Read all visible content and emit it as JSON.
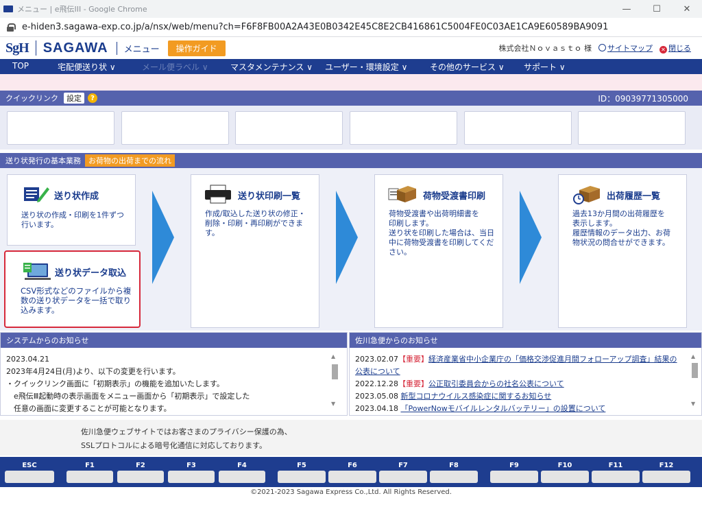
{
  "browser": {
    "title": "メニュー | e飛伝III - Google Chrome",
    "url": "e-hiden3.sagawa-exp.co.jp/a/nsx/web/menu?ch=F6F8FB00A2A43E0B0342E45C8E2CB416861C5004FE0C03AE1CA9E60589BA9091",
    "min": "—",
    "max": "☐",
    "close": "✕"
  },
  "header": {
    "logo_sgh": "SgH",
    "logo_sagawa": "SAGAWA",
    "menu_label": "メニュー",
    "guide_button": "操作ガイド",
    "company": "株式会社Ｎｏｖａｓｔｏ 様",
    "sitemap": "サイトマップ",
    "close": "閉じる"
  },
  "nav": {
    "top": "TOP",
    "items": [
      "宅配便送り状 ∨",
      "メール便ラベル ∨",
      "マスタメンテナンス ∨",
      "ユーザー・環境設定 ∨",
      "その他のサービス ∨",
      "サポート ∨"
    ]
  },
  "quicklink": {
    "label": "クイックリンク",
    "settings": "設定",
    "help": "?",
    "user_id": "ID：09039771305000"
  },
  "flow": {
    "label": "送り状発行の基本業務",
    "flow_button": "お荷物の出荷までの流れ",
    "cards": {
      "create": {
        "title": "送り状作成",
        "desc": "送り状の作成・印刷を1件ずつ\n行います。"
      },
      "import": {
        "title": "送り状データ取込",
        "desc": "CSV形式などのファイルから複\n数の送り状データを一括で取り\n込みます。"
      },
      "print": {
        "title": "送り状印刷一覧",
        "desc": "作成/取込した送り状の修正・\n削除・印刷・再印刷ができま\nす。"
      },
      "receipt": {
        "title": "荷物受渡書印刷",
        "desc": "荷物受渡書や出荷明細書を\n印刷します。\n送り状を印刷した場合は、当日\n中に荷物受渡書を印刷してくだ\nさい。"
      },
      "history": {
        "title": "出荷履歴一覧",
        "desc": "過去13か月間の出荷履歴を\n表示します。\n履歴情報のデータ出力、お荷\n物状況の問合せができます。"
      }
    }
  },
  "system_notice": {
    "header": "システムからのお知らせ",
    "lines": [
      "2023.04.21",
      "2023年4月24日(月)より、以下の変更を行います。",
      "・クイックリンク画面に「初期表示」の機能を追加いたします。",
      "　e飛伝Ⅲ起動時の表示画面をメニュー画面から「初期表示」で設定した",
      "　任意の画面に変更することが可能となります。"
    ]
  },
  "sagawa_notice": {
    "header": "佐川急便からのお知らせ",
    "items": [
      {
        "date": "2023.02.07",
        "tag": "【重要】",
        "text": "経済産業省中小企業庁の「価格交渉促進月間フォローアップ調査」結果の公表について"
      },
      {
        "date": "2022.12.28",
        "tag": "【重要】",
        "text": "公正取引委員会からの社名公表について"
      },
      {
        "date": "2023.05.08",
        "tag": "",
        "text": "新型コロナウイルス感染症に関するお知らせ"
      },
      {
        "date": "2023.04.18",
        "tag": "",
        "text": "「PowerNowモバイルレンタルバッテリー」の設置について"
      }
    ]
  },
  "privacy": {
    "line1": "佐川急便ウェブサイトではお客さまのプライバシー保護の為、",
    "line2": "SSLプロトコルによる暗号化通信に対応しております。"
  },
  "fkeys": [
    "ESC",
    "F1",
    "F2",
    "F3",
    "F4",
    "F5",
    "F6",
    "F7",
    "F8",
    "F9",
    "F10",
    "F11",
    "F12"
  ],
  "footer": "©2021-2023 Sagawa Express Co.,Ltd. All Rights Reserved.",
  "colors": {
    "brand": "#1e3d8f",
    "accent": "#f29b22",
    "arrow": "#2e8ad8",
    "highlight": "#d6283a"
  }
}
